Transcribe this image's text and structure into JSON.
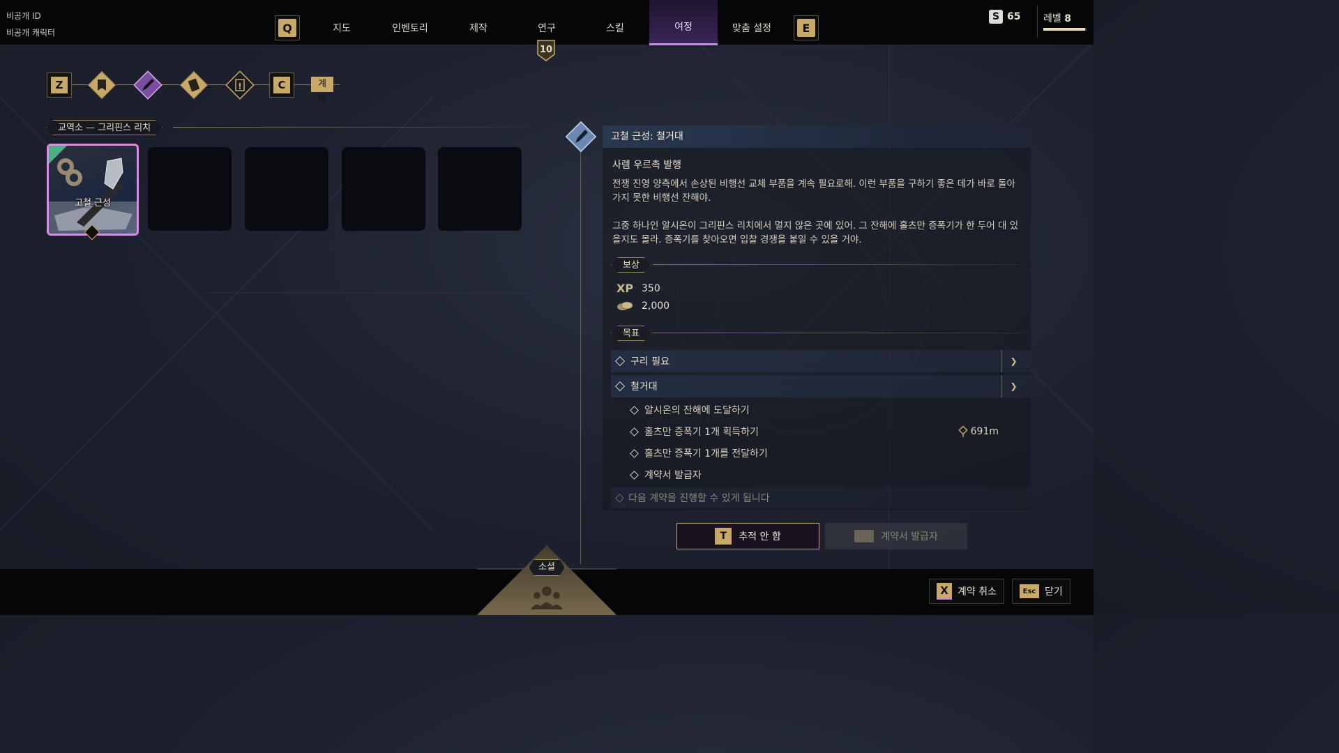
{
  "player": {
    "id_label": "비공개 ID",
    "character_label": "비공개 캐릭터"
  },
  "nav": {
    "left_key": "Q",
    "right_key": "E",
    "tabs": [
      "지도",
      "인벤토리",
      "제작",
      "연구",
      "스킬",
      "여정",
      "맞춤 설정"
    ],
    "active_tab": "여정",
    "research_badge": "10"
  },
  "currency": {
    "icon": "S",
    "amount": "65"
  },
  "level": {
    "label": "레벨",
    "value": "8",
    "progress": 0.96
  },
  "journey_nav": {
    "left_key": "Z",
    "right_key": "C",
    "icons": [
      "bookmark-icon",
      "pen-nib-icon",
      "card-icon",
      "quest-icon"
    ],
    "active_label": "계약"
  },
  "vendor": {
    "title": "교역소 — 그리핀스 리치",
    "cards": [
      {
        "title": "고철 근성",
        "selected": true
      },
      {
        "title": ""
      },
      {
        "title": ""
      },
      {
        "title": ""
      },
      {
        "title": ""
      }
    ]
  },
  "contract": {
    "title": "고철 근성: 철거대",
    "issuer": "사렘 우르촉 발행",
    "description_1": "전쟁 진영 양측에서 손상된 비행선 교체 부품을 계속 필요로해. 이런 부품을 구하기 좋은 데가 바로 돌아가지 못한 비행선 잔해야.",
    "description_2": "그중 하나인 알시온이 그리핀스 리치에서 멀지 않은 곳에 있어. 그 잔해에 홀츠만 증폭기가 한 두어 대 있을지도 몰라. 증폭기를 찾아오면 입찰 경쟁을 붙일 수 있을 거야.",
    "rewards_label": "보상",
    "xp_label": "XP",
    "xp": "350",
    "gold": "2,000",
    "objectives_label": "목표",
    "objectives": [
      {
        "label": "구리 필요",
        "done": true
      },
      {
        "label": "철거대",
        "done": false
      }
    ],
    "sub_objectives": [
      {
        "label": "알시온의 잔해에 도달하기",
        "done": true,
        "distance": ""
      },
      {
        "label": "홀츠만 증폭기 1개 획득하기",
        "done": false,
        "distance": "691m"
      },
      {
        "label": "홀츠만 증폭기 1개를 전달하기",
        "done": false,
        "distance": ""
      },
      {
        "label": "계약서 발급자",
        "done": false,
        "distance": ""
      }
    ],
    "next_contract": "다음 계약을 진행할 수 있게 됩니다",
    "track_key": "T",
    "track_label": "추적 안 함",
    "issuer_button_label": "계약서 발급자"
  },
  "footer": {
    "social_label": "소셜",
    "cancel_key": "X",
    "cancel_label": "계약 취소",
    "close_key": "Esc",
    "close_label": "닫기"
  },
  "colors": {
    "accent_gold": "#c9a968",
    "accent_purple": "#c88ce8",
    "bg": "#1e2230"
  }
}
